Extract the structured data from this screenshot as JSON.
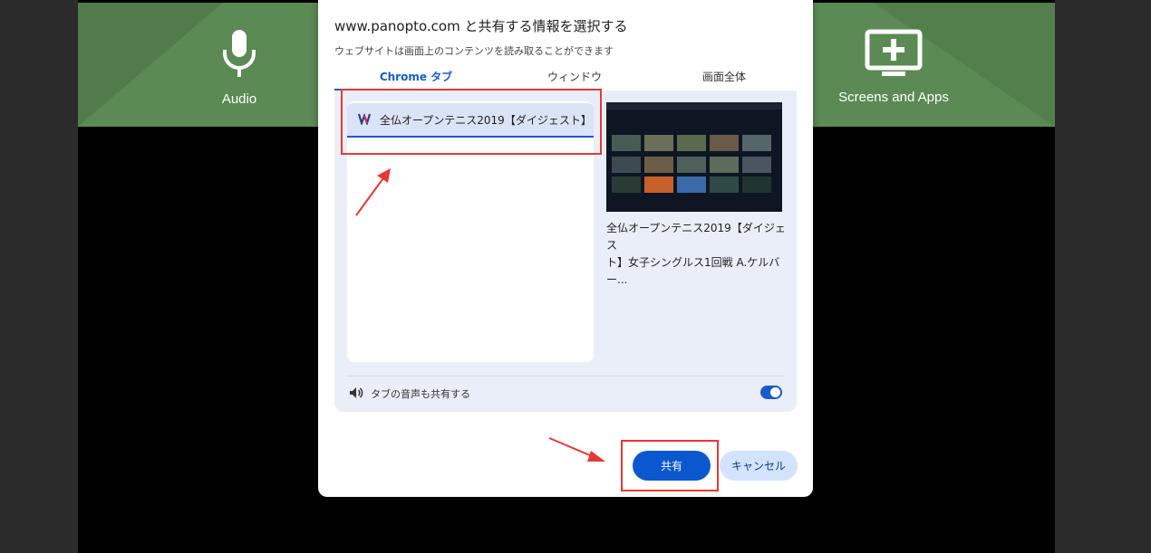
{
  "banner": {
    "audio_label": "Audio",
    "screens_label": "Screens and Apps",
    "color": "#5b8a54"
  },
  "dialog": {
    "title": "www.panopto.com と共有する情報を選択する",
    "subtitle": "ウェブサイトは画面上のコンテンツを読み取ることができます",
    "tabs": [
      {
        "label": "Chrome タブ",
        "active": true
      },
      {
        "label": "ウィンドウ",
        "active": false
      },
      {
        "label": "画面全体",
        "active": false
      }
    ],
    "tab_list": [
      {
        "title": "全仏オープンテニス2019【ダイジェスト】..."
      }
    ],
    "preview_caption_line1": "全仏オープンテニス2019【ダイジェス",
    "preview_caption_line2": "ト】女子シングルス1回戦 A.ケルバー...",
    "audio_share_label": "タブの音声も共有する",
    "audio_share_on": true,
    "share_button": "共有",
    "cancel_button": "キャンセル",
    "accent_color": "#0b57d0",
    "highlight_color": "#e53935"
  }
}
